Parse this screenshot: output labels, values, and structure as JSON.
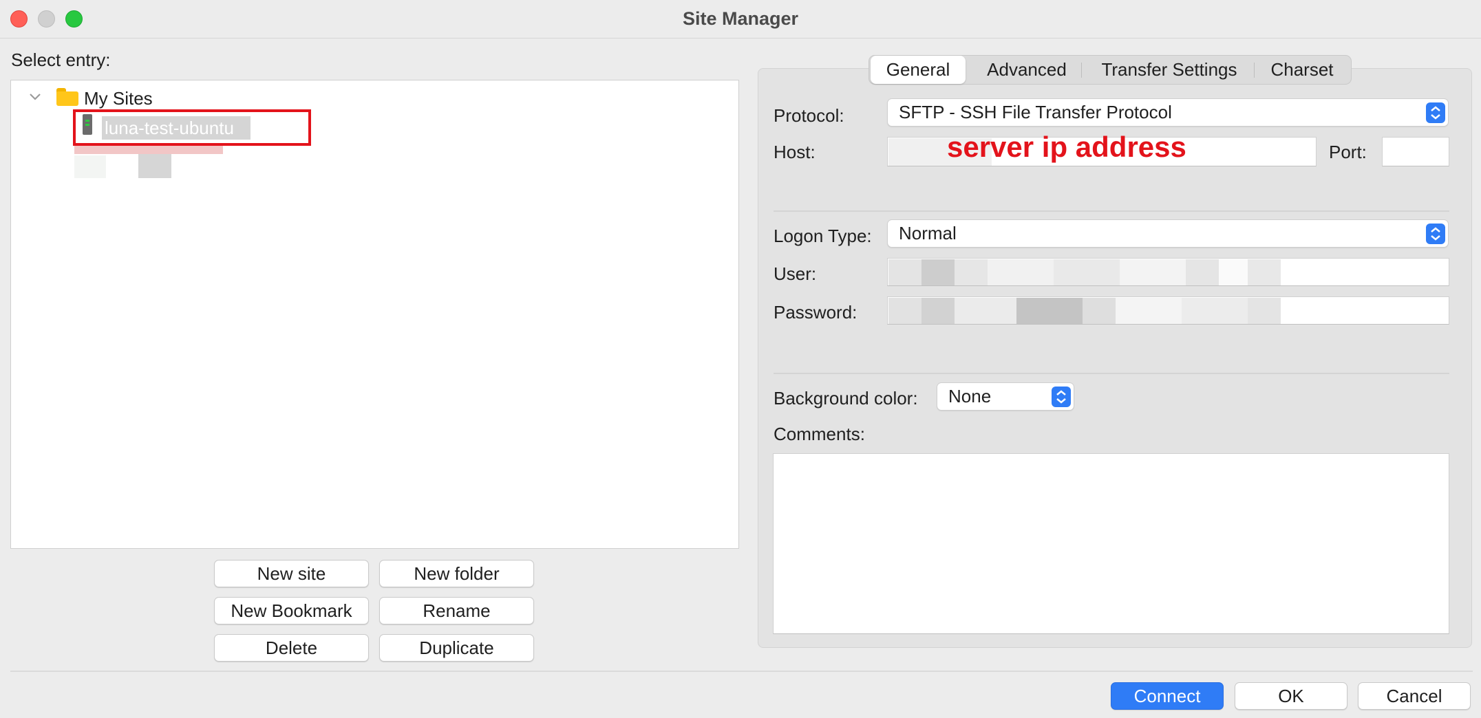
{
  "window": {
    "title": "Site Manager"
  },
  "left": {
    "select_label": "Select entry:",
    "tree": {
      "root": "My Sites",
      "selected_site": "luna-test-ubuntu"
    },
    "buttons": {
      "new_site": "New site",
      "new_folder": "New folder",
      "new_bookmark": "New Bookmark",
      "rename": "Rename",
      "delete": "Delete",
      "duplicate": "Duplicate"
    }
  },
  "tabs": [
    {
      "label": "General",
      "active": true
    },
    {
      "label": "Advanced",
      "active": false
    },
    {
      "label": "Transfer Settings",
      "active": false
    },
    {
      "label": "Charset",
      "active": false
    }
  ],
  "general": {
    "protocol_label": "Protocol:",
    "protocol_value": "SFTP - SSH File Transfer Protocol",
    "host_label": "Host:",
    "host_annotation": "server ip address",
    "port_label": "Port:",
    "port_value": "",
    "logon_type_label": "Logon Type:",
    "logon_type_value": "Normal",
    "user_label": "User:",
    "password_label": "Password:",
    "bg_color_label": "Background color:",
    "bg_color_value": "None",
    "comments_label": "Comments:",
    "comments_value": ""
  },
  "footer": {
    "connect": "Connect",
    "ok": "OK",
    "cancel": "Cancel"
  },
  "colors": {
    "accent": "#2f7cf6",
    "annotation_red": "#e3131b"
  }
}
